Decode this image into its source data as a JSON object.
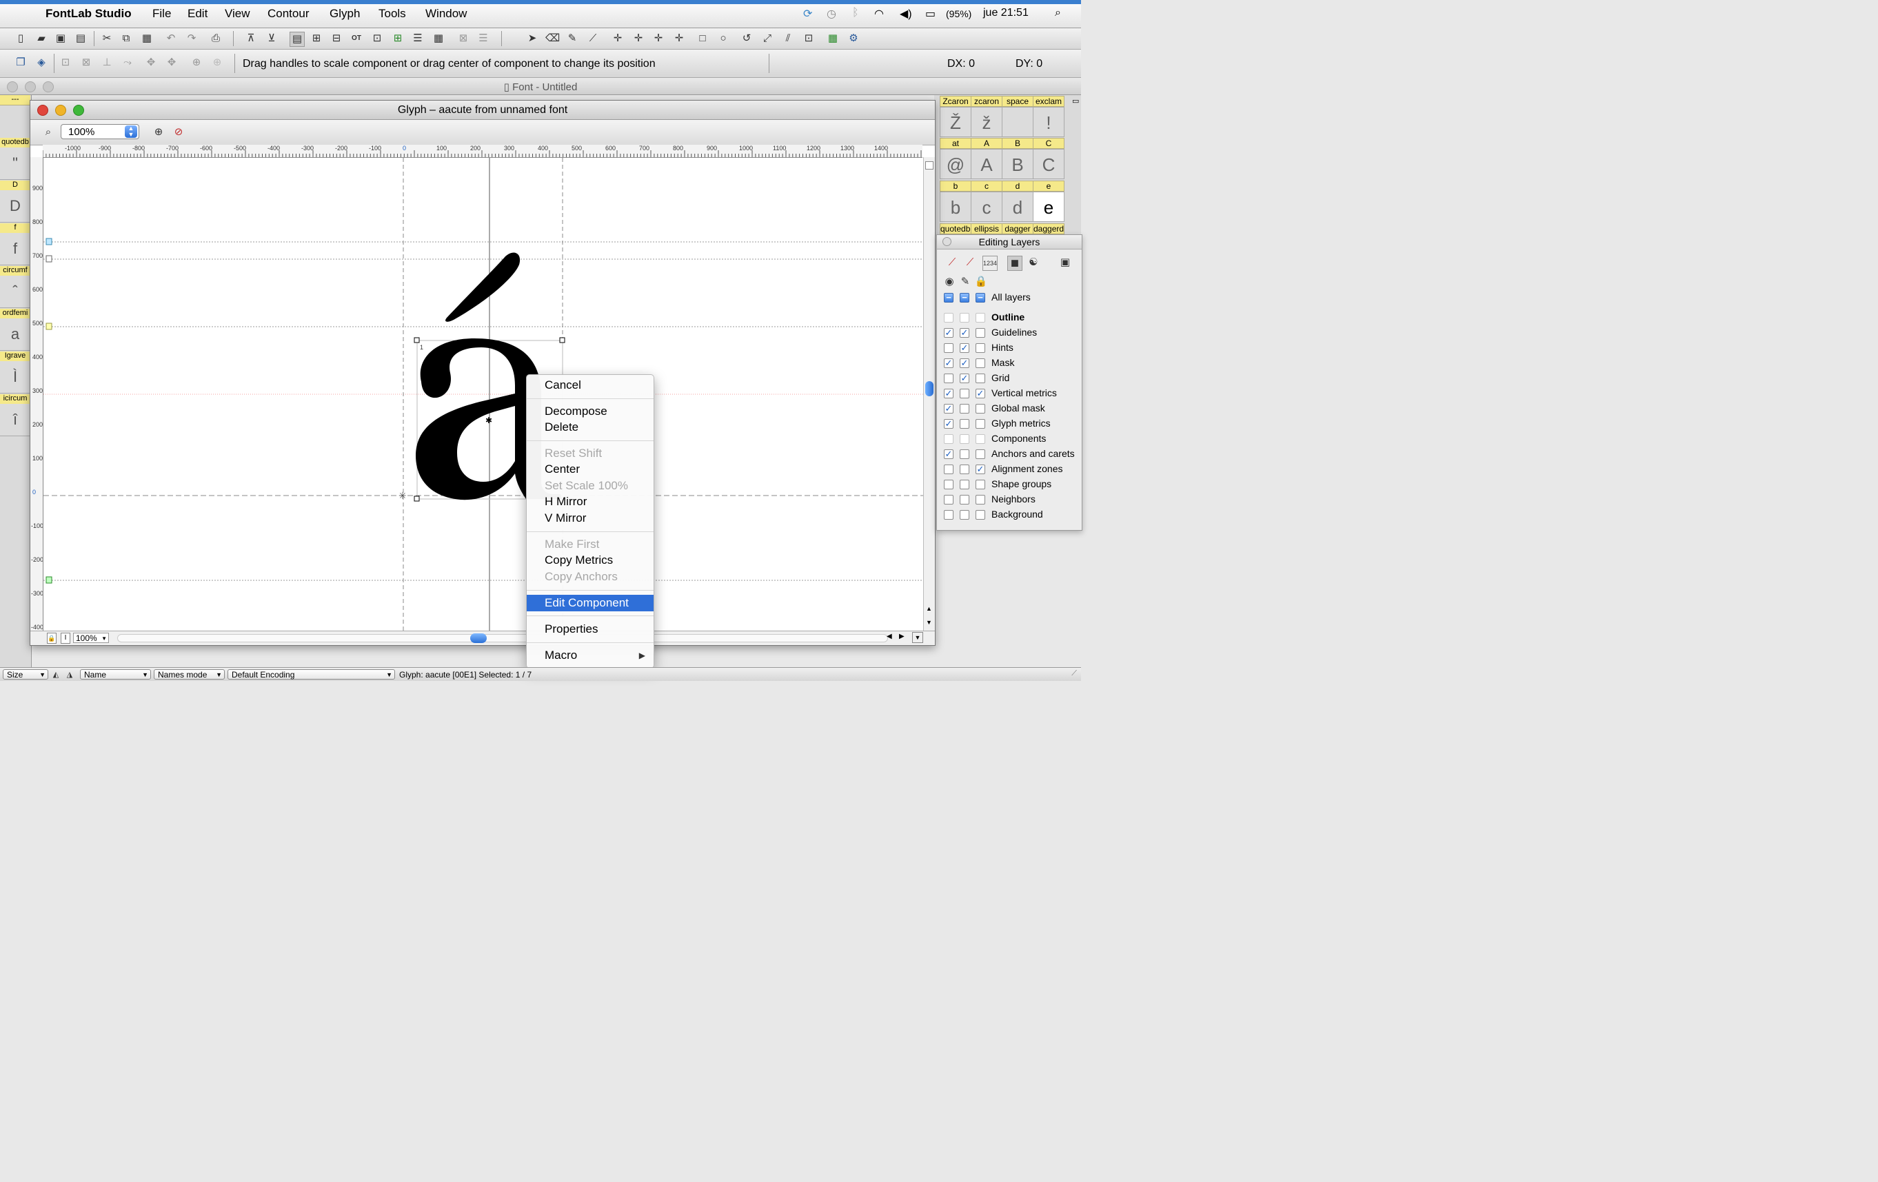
{
  "menubar": {
    "app_name": "FontLab Studio",
    "items": [
      "File",
      "Edit",
      "View",
      "Contour",
      "Glyph",
      "Tools",
      "Window"
    ],
    "battery": "(95%)",
    "clock": "jue 21:51"
  },
  "toolbar2": {
    "hint": "Drag handles to scale component or drag center of component to change its position",
    "dx": "DX: 0",
    "dy": "DY: 0"
  },
  "font_window": {
    "title": "Font - Untitled",
    "left_cells": [
      {
        "label": "---",
        "glyph": ""
      },
      {
        "label": "quotedb",
        "glyph": "\""
      },
      {
        "label": "D",
        "glyph": "D"
      },
      {
        "label": "f",
        "glyph": "f"
      },
      {
        "label": "circumf",
        "glyph": "ˆ"
      },
      {
        "label": "ordfemi",
        "glyph": "a"
      },
      {
        "label": "Igrave",
        "glyph": "Ì"
      },
      {
        "label": "icircum",
        "glyph": "î"
      }
    ],
    "right_rows": [
      {
        "labels": [
          "Zcaron",
          "zcaron",
          "space",
          "exclam"
        ],
        "glyphs": [
          "Ž",
          "ž",
          "",
          "!"
        ]
      },
      {
        "labels": [
          "at",
          "A",
          "B",
          "C"
        ],
        "glyphs": [
          "@",
          "A",
          "B",
          "C"
        ]
      },
      {
        "labels": [
          "b",
          "c",
          "d",
          "e"
        ],
        "glyphs": [
          "b",
          "c",
          "d",
          "e"
        ]
      },
      {
        "labels": [
          "quotedbl",
          "ellipsis",
          "dagger",
          "daggerdbl"
        ],
        "glyphs": []
      }
    ]
  },
  "glyph_window": {
    "title": "Glyph – aacute from unnamed font",
    "zoom": "100%",
    "status_zoom": "100%",
    "glyph_char": "á",
    "hruler_labels": [
      "-1000",
      "-900",
      "-800",
      "-700",
      "-600",
      "-500",
      "-400",
      "-300",
      "-200",
      "-100",
      "0",
      "100",
      "200",
      "300",
      "400",
      "500",
      "600",
      "700",
      "800",
      "900",
      "1000",
      "1100",
      "1200",
      "1300",
      "1400"
    ],
    "vruler_labels": [
      "900",
      "800",
      "700",
      "600",
      "500",
      "400",
      "300",
      "200",
      "100",
      "0",
      "-100",
      "-200",
      "-300",
      "-400"
    ]
  },
  "layers_panel": {
    "title": "Editing Layers",
    "all_layers": "All layers",
    "rows": [
      {
        "name": "Outline",
        "c1": false,
        "c2": false,
        "c3": false,
        "bold": true
      },
      {
        "name": "Guidelines",
        "c1": true,
        "c2": true,
        "c3": false
      },
      {
        "name": "Hints",
        "c1": false,
        "c2": true,
        "c3": false
      },
      {
        "name": "Mask",
        "c1": true,
        "c2": true,
        "c3": false
      },
      {
        "name": "Grid",
        "c1": false,
        "c2": true,
        "c3": false
      },
      {
        "name": "Vertical metrics",
        "c1": true,
        "c2": false,
        "c3": true
      },
      {
        "name": "Global mask",
        "c1": true,
        "c2": false,
        "c3": false
      },
      {
        "name": "Glyph metrics",
        "c1": true,
        "c2": false,
        "c3": false
      },
      {
        "name": "Components",
        "c1": false,
        "c2": false,
        "c3": false
      },
      {
        "name": "Anchors and carets",
        "c1": true,
        "c2": false,
        "c3": false
      },
      {
        "name": "Alignment zones",
        "c1": false,
        "c2": false,
        "c3": true
      },
      {
        "name": "Shape groups",
        "c1": false,
        "c2": false,
        "c3": false
      },
      {
        "name": "Neighbors",
        "c1": false,
        "c2": false,
        "c3": false
      },
      {
        "name": "Background",
        "c1": false,
        "c2": false,
        "c3": false
      }
    ]
  },
  "context_menu": {
    "items": [
      {
        "label": "Cancel",
        "enabled": true
      },
      {
        "label": "Decompose",
        "enabled": true
      },
      {
        "label": "Delete",
        "enabled": true
      },
      {
        "label": "Reset Shift",
        "enabled": false
      },
      {
        "label": "Center",
        "enabled": true
      },
      {
        "label": "Set Scale 100%",
        "enabled": false
      },
      {
        "label": "H Mirror",
        "enabled": true
      },
      {
        "label": "V Mirror",
        "enabled": true
      },
      {
        "label": "Make First",
        "enabled": false
      },
      {
        "label": "Copy Metrics",
        "enabled": true
      },
      {
        "label": "Copy Anchors",
        "enabled": false
      },
      {
        "label": "Edit Component",
        "enabled": true,
        "selected": true
      },
      {
        "label": "Properties",
        "enabled": true
      },
      {
        "label": "Macro",
        "enabled": true,
        "submenu": true
      }
    ]
  },
  "bottombar": {
    "size_select": "Size",
    "name_select": "Name",
    "mode_select": "Names mode",
    "encoding_select": "Default Encoding",
    "status": "Glyph: aacute [00E1]  Selected: 1 / 7"
  },
  "colors": {
    "accent": "#2f6fd8",
    "label_yellow": "#f5e98a",
    "close_red": "#e0463c",
    "min_yellow": "#f0b429",
    "zoom_green": "#3fb83a"
  }
}
